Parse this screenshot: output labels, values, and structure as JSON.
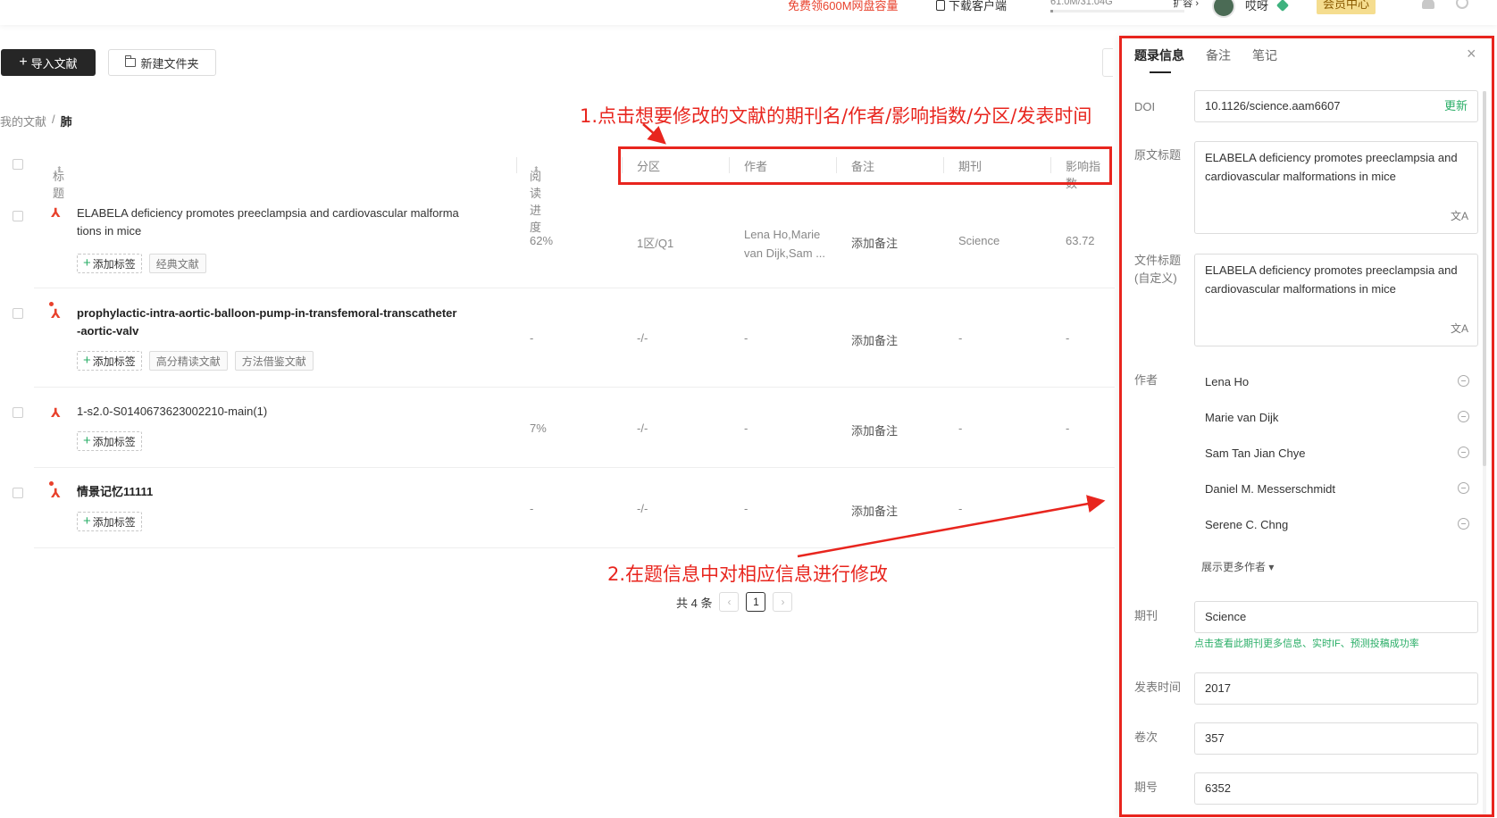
{
  "topbar": {
    "promo": "免费领600M网盘容量",
    "download": "下载客户端",
    "storage": "61.0M/31.04G",
    "storage_fraction": 0.002,
    "expand": "扩容 ›",
    "username": "哎呀",
    "member": "会员中心"
  },
  "toolbar": {
    "import_label": "导入文献",
    "new_folder_label": "新建文件夹"
  },
  "breadcrumb": {
    "root": "我的文献",
    "sep": "/",
    "current": "肺"
  },
  "table": {
    "headers": {
      "title": "标题",
      "progress": "阅读进度",
      "zone": "分区",
      "author": "作者",
      "note": "备注",
      "journal": "期刊",
      "impact": "影响指数"
    },
    "add_tag": "添加标签",
    "rows": [
      {
        "title": "ELABELA deficiency promotes preeclampsia and cardiovascular malformations in mice",
        "tags": [
          "经典文献"
        ],
        "progress": "62%",
        "zone": "1区/Q1",
        "author": "Lena Ho,Marie van Dijk,Sam ...",
        "note": "添加备注",
        "journal": "Science",
        "impact": "63.72"
      },
      {
        "title": "prophylactic-intra-aortic-balloon-pump-in-transfemoral-transcatheter-aortic-valv",
        "tags": [
          "高分精读文献",
          "方法借鉴文献"
        ],
        "progress": "-",
        "zone": "-/-",
        "author": "-",
        "note": "添加备注",
        "journal": "-",
        "impact": "-"
      },
      {
        "title": "1-s2.0-S0140673623002210-main(1)",
        "tags": [],
        "progress": "7%",
        "zone": "-/-",
        "author": "-",
        "note": "添加备注",
        "journal": "-",
        "impact": "-"
      },
      {
        "title": "情景记忆11111",
        "tags": [],
        "progress": "-",
        "zone": "-/-",
        "author": "-",
        "note": "添加备注",
        "journal": "-",
        "impact": ""
      }
    ]
  },
  "pager": {
    "total": "共 4 条",
    "prev": "‹",
    "current": "1",
    "next": "›"
  },
  "annotations": {
    "step1": "1.点击想要修改的文献的期刊名/作者/影响指数/分区/发表时间",
    "step2": "2.在题信息中对相应信息进行修改",
    "color": "#e8251e"
  },
  "panel": {
    "tabs": [
      "题录信息",
      "备注",
      "笔记"
    ],
    "close": "×",
    "doi_label": "DOI",
    "doi": "10.1126/science.aam6607",
    "update": "更新",
    "orig_title_label": "原文标题",
    "orig_title": "ELABELA deficiency promotes preeclampsia and cardiovascular malformations in mice",
    "file_title_label_1": "文件标题",
    "file_title_label_2": "(自定义)",
    "file_title": "ELABELA deficiency promotes preeclampsia and cardiovascular malformations in mice",
    "translate_icon": "文A",
    "authors_label": "作者",
    "authors": [
      "Lena Ho",
      "Marie van Dijk",
      "Sam Tan Jian Chye",
      "Daniel M. Messerschmidt",
      "Serene C. Chng"
    ],
    "more_authors": "展示更多作者 ▾",
    "journal_label": "期刊",
    "journal": "Science",
    "journal_link": "点击查看此期刊更多信息、实时IF、预测投稿成功率",
    "pub_time_label": "发表时间",
    "pub_time": "2017",
    "volume_label": "卷次",
    "volume": "357",
    "issue_label": "期号",
    "issue": "6352"
  },
  "colors": {
    "accent_green": "#2aae67",
    "annotation_red": "#e8251e",
    "pdf_red": "#e8412c",
    "import_button": "#262626"
  }
}
